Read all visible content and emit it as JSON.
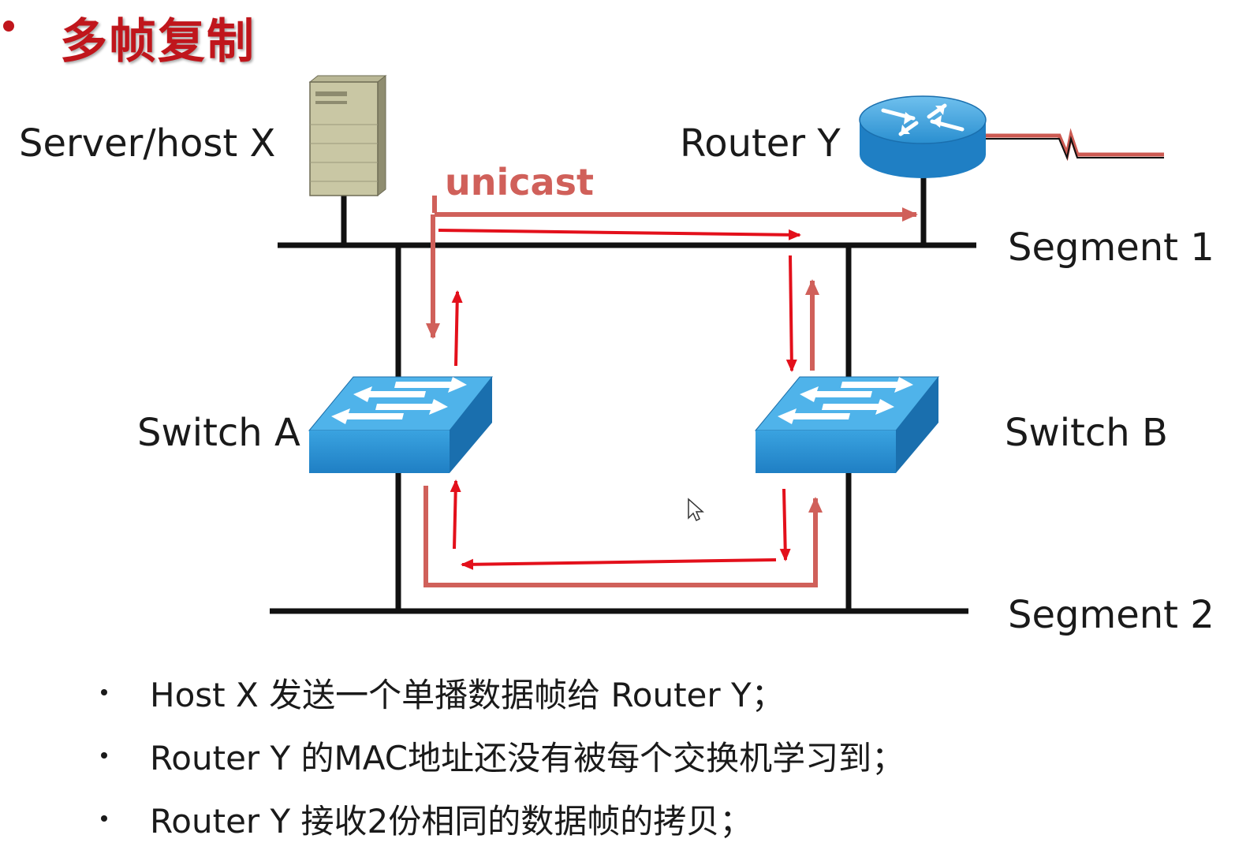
{
  "title": "多帧复制",
  "labels": {
    "server": "Server/host X",
    "router": "Router Y",
    "unicast": "unicast",
    "segment1": "Segment 1",
    "segment2": "Segment 2",
    "switch_a": "Switch A",
    "switch_b": "Switch B"
  },
  "bullets": [
    "Host X 发送一个单播数据帧给 Router Y；",
    "Router Y 的MAC地址还没有被每个交换机学习到；",
    "Router Y 接收2份相同的数据帧的拷贝；"
  ],
  "colors": {
    "title": "#c0161c",
    "frame_path": "#d0605a",
    "copy_arrow": "#e3101b",
    "wire": "#111111",
    "switch": "#2a8fd0",
    "router": "#2a8fd0",
    "server": "#c9c7a4"
  },
  "icons": [
    "server-icon",
    "router-icon",
    "switch-icon"
  ]
}
